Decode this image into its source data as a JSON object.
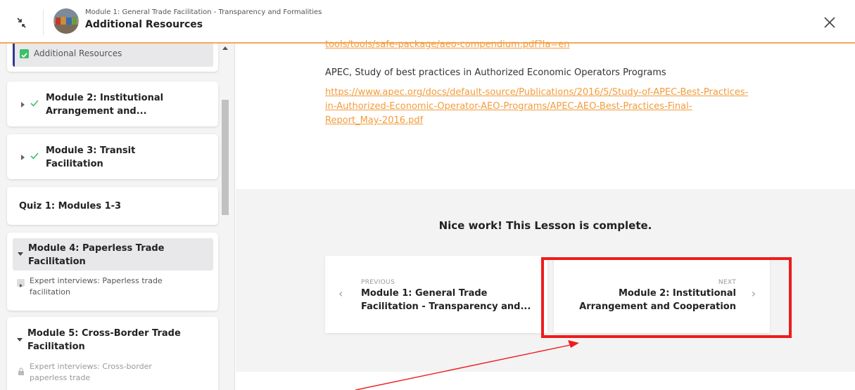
{
  "header": {
    "course_subtitle": "Module 1: General Trade Facilitation - Transparency and Formalities",
    "lesson_title": "Additional Resources",
    "collapse_icon": "collapse-arrows-icon",
    "close_icon": "close-icon"
  },
  "sidebar": {
    "active_lesson": "Additional Resources",
    "modules": [
      {
        "title_line1": "Module 2: Institutional",
        "title_line2": "Arrangement and..."
      },
      {
        "title_line1": "Module 3: Transit",
        "title_line2": "Facilitation"
      }
    ],
    "quiz": "Quiz 1: Modules 1-3",
    "module4": {
      "title_line1": "Module 4: Paperless Trade",
      "title_line2": "Facilitation",
      "lesson_line1": "Expert interviews: Paperless trade",
      "lesson_line2": "facilitation"
    },
    "module5": {
      "title_line1": "Module 5: Cross-Border Trade",
      "title_line2": "Facilitation",
      "lesson_line1": "Expert interviews: Cross-border",
      "lesson_line2": "paperless trade"
    }
  },
  "main": {
    "cut_link": "tools/tools/safe-package/aeo-compendium.pdf?la=en",
    "ref_text": "APEC, Study of best practices in Authorized Economic Operators Programs",
    "ref_link_line1": "https://www.apec.org/docs/default-source/Publications/2016/5/Study-of-APEC-Best-Practices-",
    "ref_link_line2": "in-Authorized-Economic-Operator-AEO-Programs/APEC-AEO-Best-Practices-Final-",
    "ref_link_line3": "Report_May-2016.pdf",
    "complete_message": "Nice work! This Lesson is complete.",
    "prev": {
      "label": "PREVIOUS",
      "title_line1": "Module 1: General Trade",
      "title_line2": "Facilitation - Transparency and..."
    },
    "next": {
      "label": "NEXT",
      "title_line1": "Module 2: Institutional",
      "title_line2": "Arrangement and Cooperation"
    }
  },
  "colors": {
    "accent": "#f39c3c",
    "check_green": "#3cc06a",
    "highlight_red": "#ee1c1c",
    "active_bar": "#2f3a8f"
  }
}
